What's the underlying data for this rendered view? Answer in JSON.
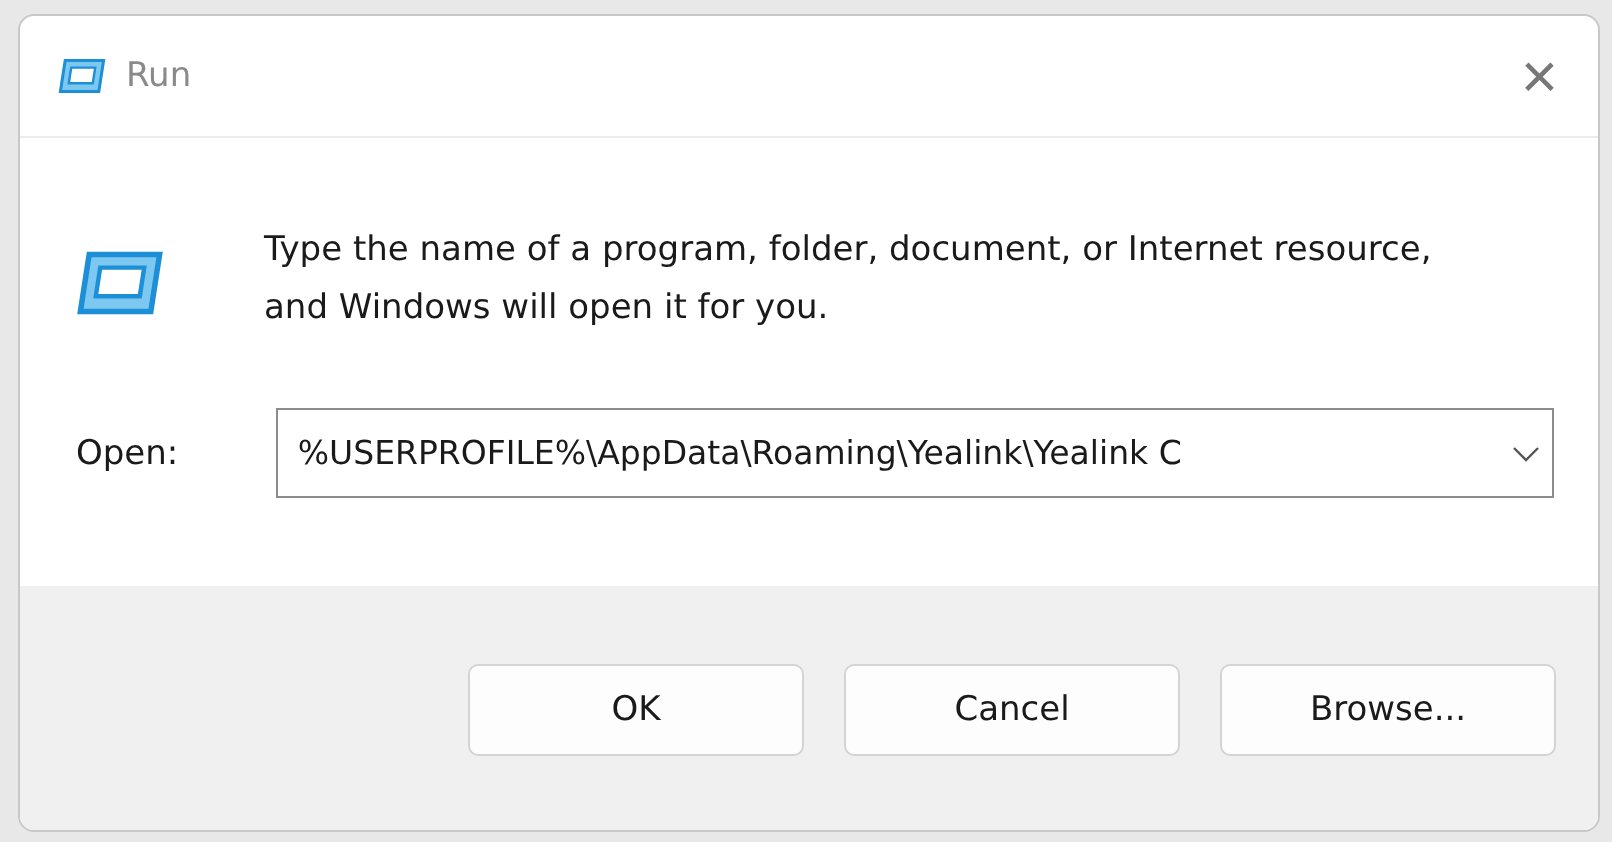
{
  "window": {
    "title": "Run",
    "close": "×"
  },
  "message": "Type the name of a program, folder, document, or Internet resource, and Windows will open it for you.",
  "open_field": {
    "label": "Open:",
    "value": "%USERPROFILE%\\AppData\\Roaming\\Yealink\\Yealink C"
  },
  "buttons": [
    {
      "label": "OK"
    },
    {
      "label": "Cancel"
    },
    {
      "label": "Browse..."
    }
  ]
}
